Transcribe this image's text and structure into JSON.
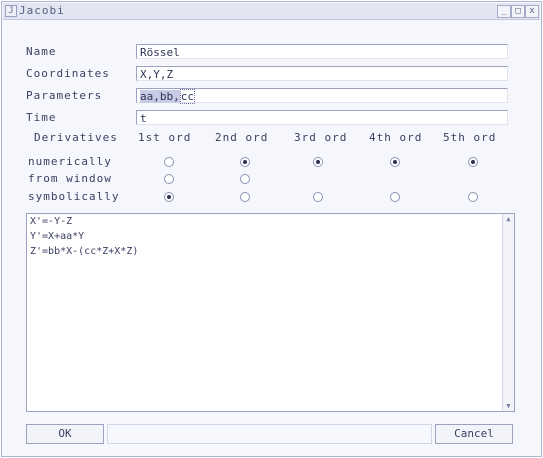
{
  "window": {
    "title": "Jacobi",
    "controls": {
      "minimize": "_",
      "maximize": "□",
      "close": "x"
    }
  },
  "form": {
    "name_label": "Name",
    "name_value": "Rössel",
    "coordinates_label": "Coordinates",
    "coordinates_value": "X,Y,Z",
    "parameters_label": "Parameters",
    "parameters_value_part1": "aa",
    "parameters_value_part2": "bb",
    "parameters_value_part3": "cc",
    "parameters_separator": ",",
    "time_label": "Time",
    "time_value": "t"
  },
  "derivatives": {
    "label": "Derivatives",
    "columns": [
      "1st ord",
      "2nd ord",
      "3rd ord",
      "4th ord",
      "5th ord"
    ],
    "rows": [
      {
        "label": "numerically",
        "selected": [
          false,
          true,
          true,
          true,
          true
        ],
        "present": [
          true,
          true,
          true,
          true,
          true
        ]
      },
      {
        "label": "from window",
        "selected": [
          false,
          false,
          false,
          false,
          false
        ],
        "present": [
          true,
          true,
          false,
          false,
          false
        ]
      },
      {
        "label": "symbolically",
        "selected": [
          true,
          false,
          false,
          false,
          false
        ],
        "present": [
          true,
          true,
          true,
          true,
          true
        ]
      }
    ]
  },
  "equations": [
    "X'=-Y-Z",
    "Y'=X+aa*Y",
    "Z'=bb*X-(cc*Z+X*Z)"
  ],
  "buttons": {
    "ok": "OK",
    "cancel": "Cancel"
  }
}
